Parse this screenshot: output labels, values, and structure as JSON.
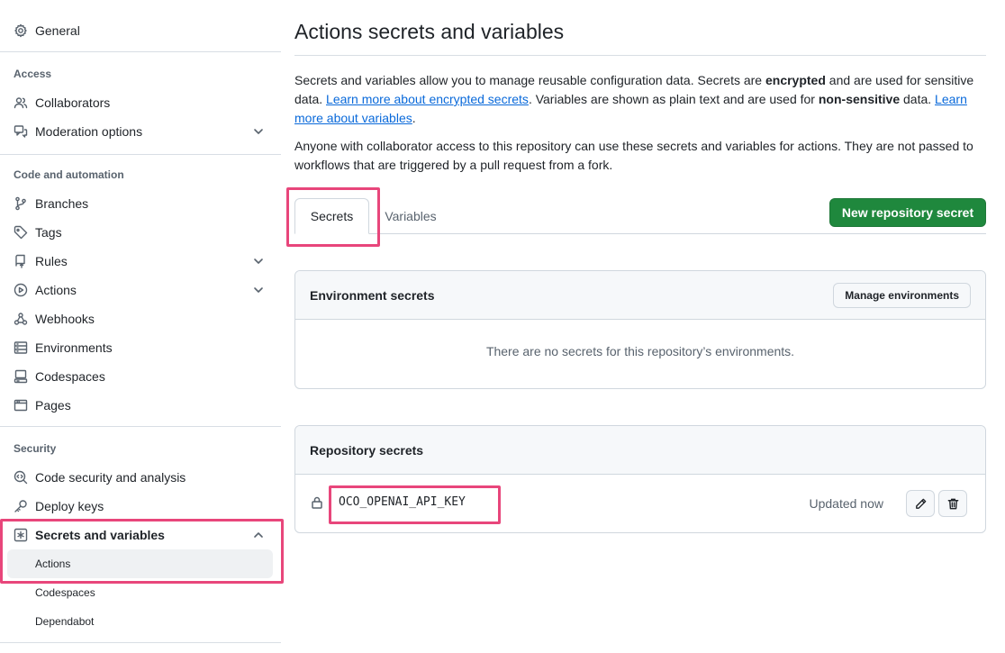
{
  "sidebar": {
    "general": "General",
    "sections": {
      "access": "Access",
      "code_automation": "Code and automation",
      "security": "Security"
    },
    "items": {
      "collaborators": "Collaborators",
      "moderation": "Moderation options",
      "branches": "Branches",
      "tags": "Tags",
      "rules": "Rules",
      "actions": "Actions",
      "webhooks": "Webhooks",
      "environments": "Environments",
      "codespaces": "Codespaces",
      "pages": "Pages",
      "code_security": "Code security and analysis",
      "deploy_keys": "Deploy keys",
      "secrets_variables": "Secrets and variables"
    },
    "subitems": {
      "actions": "Actions",
      "codespaces": "Codespaces",
      "dependabot": "Dependabot"
    }
  },
  "main": {
    "title": "Actions secrets and variables",
    "desc1": {
      "p1": "Secrets and variables allow you to manage reusable configuration data. Secrets are ",
      "b1": "encrypted",
      "p2": " and are used for sensitive data. ",
      "link1": "Learn more about encrypted secrets",
      "p3": ". Variables are shown as plain text and are used for ",
      "b2": "non-sensitive",
      "p4": " data. ",
      "link2": "Learn more about variables",
      "p5": "."
    },
    "desc2": "Anyone with collaborator access to this repository can use these secrets and variables for actions. They are not passed to workflows that are triggered by a pull request from a fork.",
    "tabs": {
      "secrets": "Secrets",
      "variables": "Variables"
    },
    "new_secret_button": "New repository secret",
    "env_secrets": {
      "title": "Environment secrets",
      "manage_button": "Manage environments",
      "empty": "There are no secrets for this repository’s environments."
    },
    "repo_secrets": {
      "title": "Repository secrets",
      "rows": [
        {
          "name": "OCO_OPENAI_API_KEY",
          "updated": "Updated now"
        }
      ]
    }
  },
  "colors": {
    "primary": "#1f883d",
    "link": "#0969da",
    "annotation": "#e8467b"
  }
}
